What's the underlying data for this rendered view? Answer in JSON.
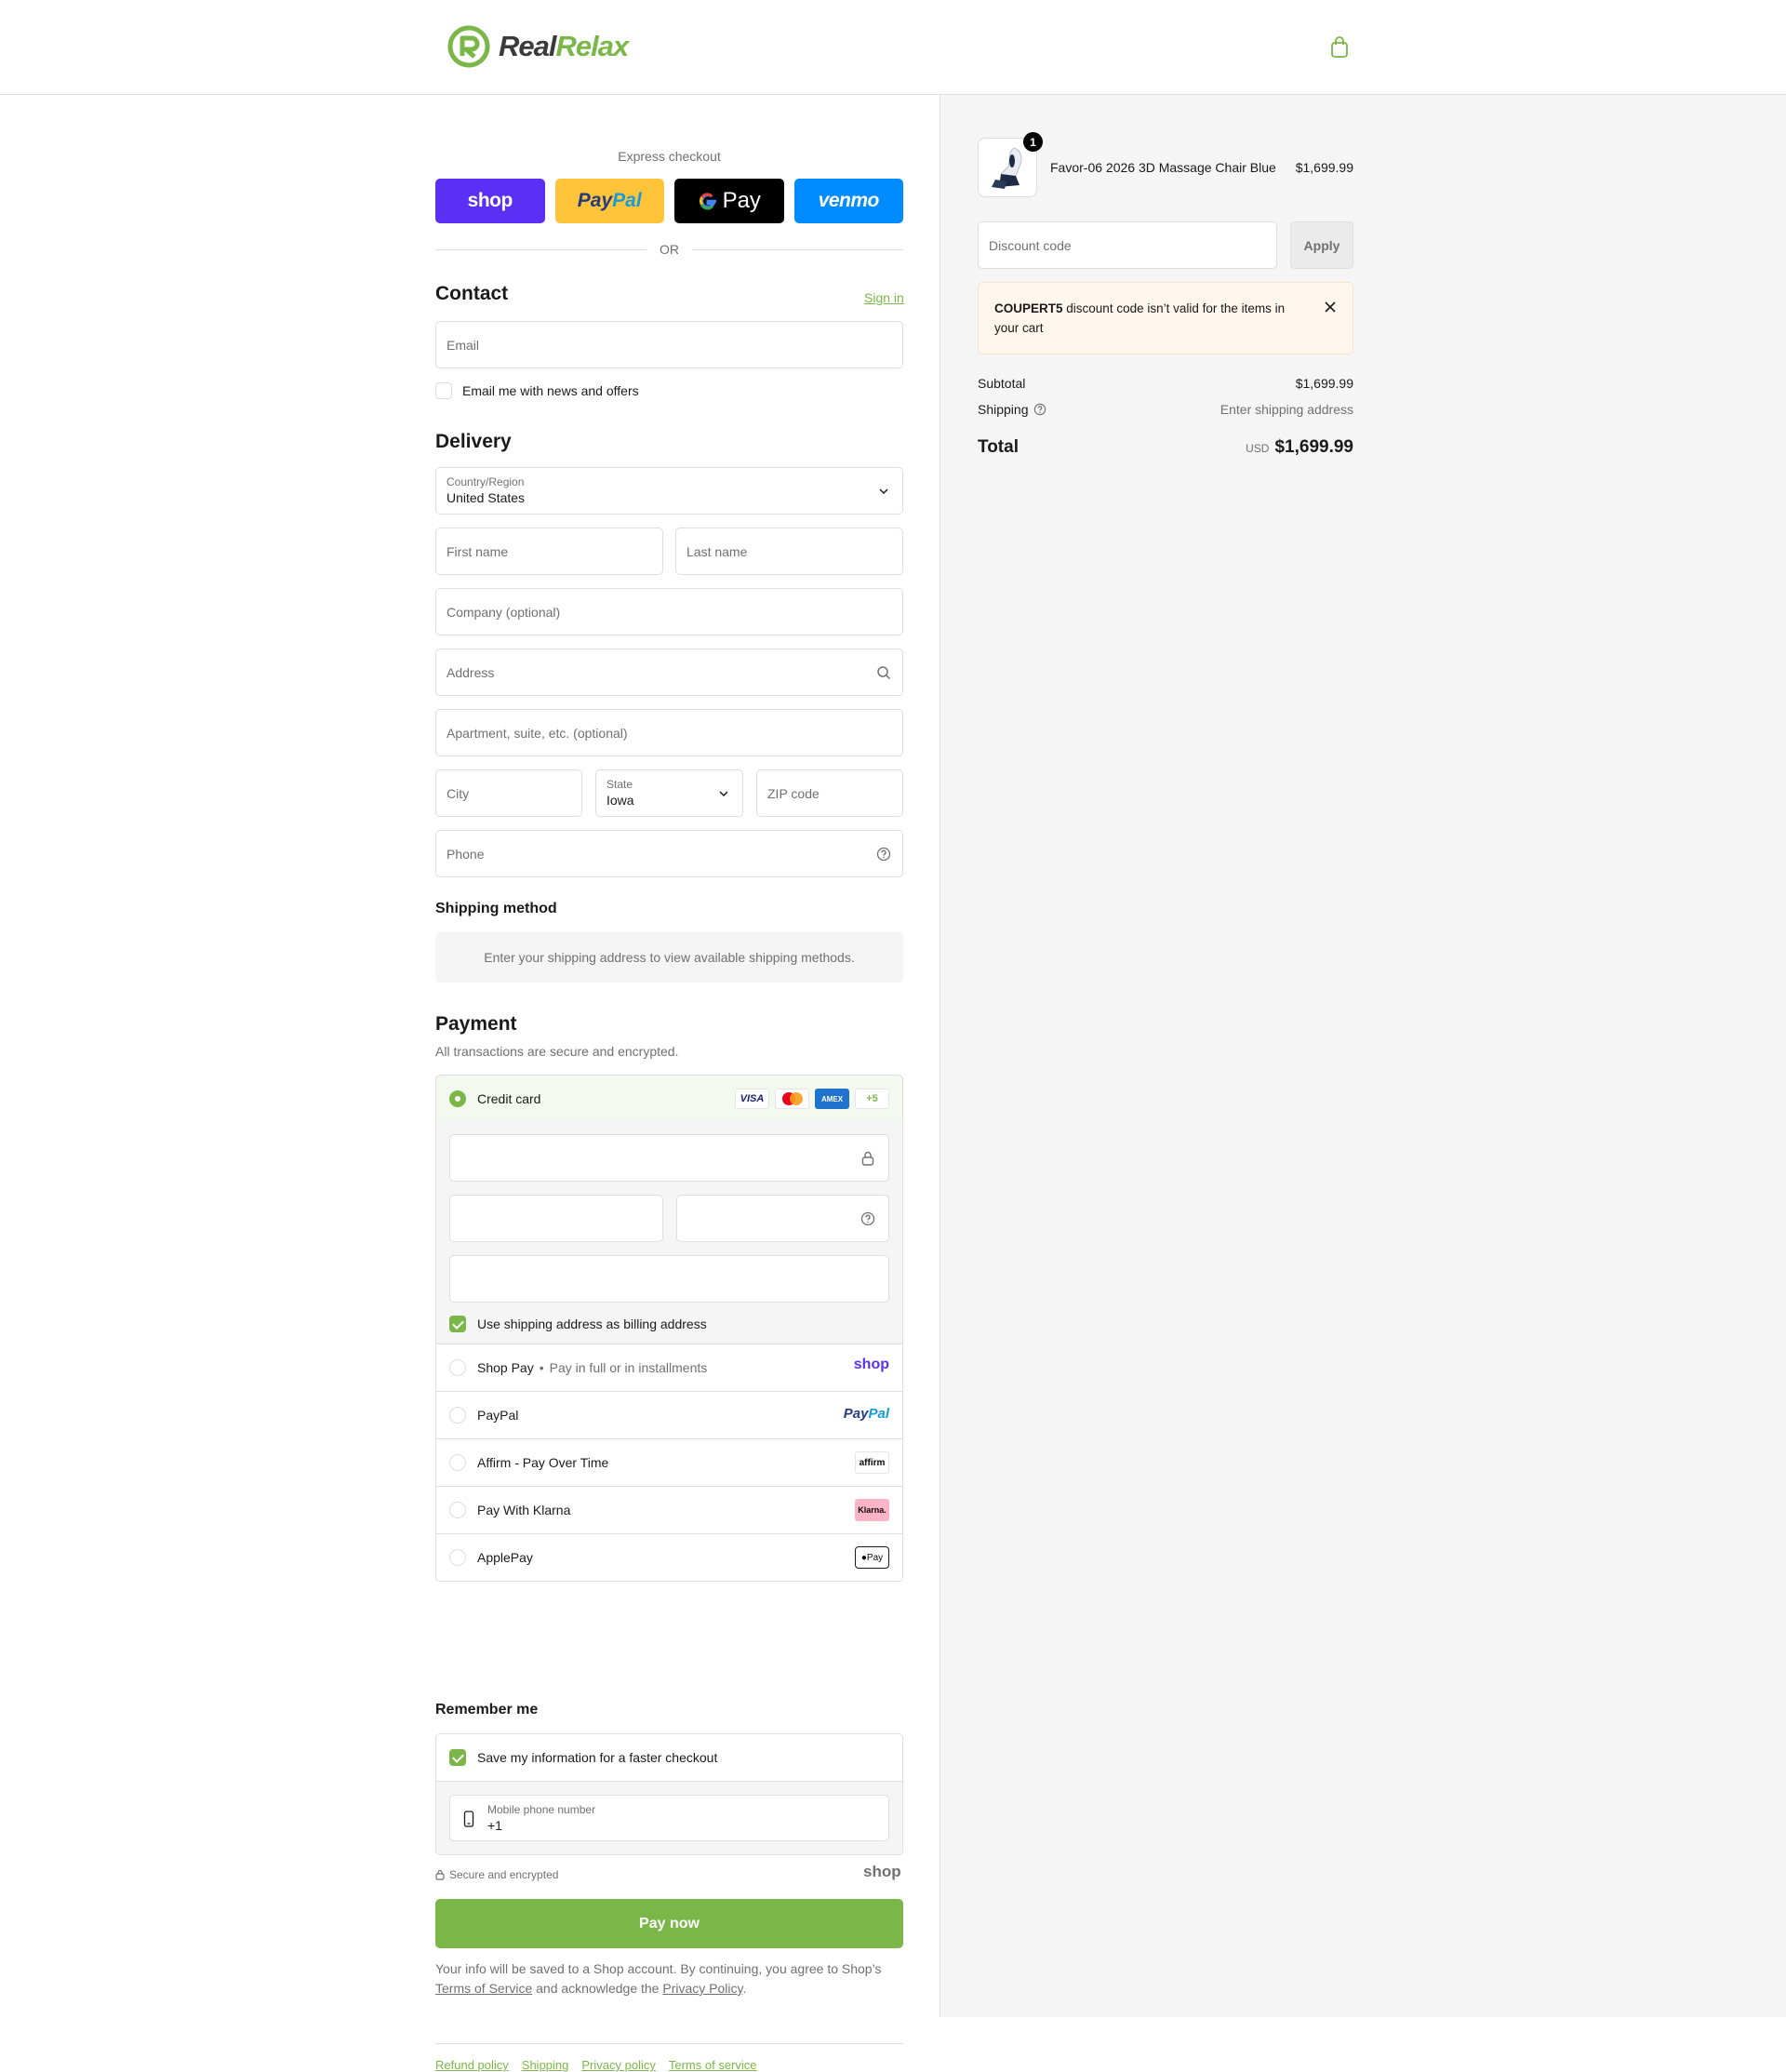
{
  "brand": {
    "part1": "Real",
    "part2": "Relax"
  },
  "express": {
    "title": "Express checkout",
    "shop_label": "shop",
    "paypal_a": "Pay",
    "paypal_b": "Pal",
    "gpay_label": "Pay",
    "venmo_label": "venmo",
    "or_label": "OR"
  },
  "contact": {
    "heading": "Contact",
    "sign_in": "Sign in",
    "email_placeholder": "Email",
    "news_label": "Email me with news and offers"
  },
  "delivery": {
    "heading": "Delivery",
    "country_label": "Country/Region",
    "country_value": "United States",
    "first_name": "First name",
    "last_name": "Last name",
    "company": "Company (optional)",
    "address": "Address",
    "apartment": "Apartment, suite, etc. (optional)",
    "city": "City",
    "state_label": "State",
    "state_value": "Iowa",
    "zip": "ZIP code",
    "phone": "Phone"
  },
  "shipping_method": {
    "heading": "Shipping method",
    "message": "Enter your shipping address to view available shipping methods."
  },
  "payment": {
    "heading": "Payment",
    "subtitle": "All transactions are secure and encrypted.",
    "credit_card": "Credit card",
    "card_brands": [
      "VISA",
      "AMEX",
      "+5"
    ],
    "billing_label": "Use shipping address as billing address",
    "options": [
      {
        "label": "Shop Pay",
        "sub": "Pay in full or in installments",
        "logo": "shop"
      },
      {
        "label": "PayPal",
        "logo_a": "Pay",
        "logo_b": "Pal"
      },
      {
        "label": "Affirm - Pay Over Time",
        "logo": "affirm"
      },
      {
        "label": "Pay With Klarna",
        "logo": "Klarna."
      },
      {
        "label": "ApplePay",
        "logo": "Pay"
      }
    ]
  },
  "remember": {
    "heading": "Remember me",
    "save_label": "Save my information for a faster checkout",
    "mobile_label": "Mobile phone number",
    "mobile_value": "+1",
    "secure_label": "Secure and encrypted",
    "shop_logo": "shop"
  },
  "pay_now": "Pay now",
  "legal": {
    "text1": "Your info will be saved to a Shop account. By continuing, you agree to Shop’s",
    "terms": "Terms of Service",
    "text2": "and acknowledge the",
    "privacy": "Privacy Policy",
    "end": "."
  },
  "footer": [
    "Refund policy",
    "Shipping",
    "Privacy policy",
    "Terms of service"
  ],
  "summary": {
    "product_name": "Favor-06 2026 3D Massage Chair Blue",
    "product_price": "$1,699.99",
    "qty": "1",
    "discount_placeholder": "Discount code",
    "apply": "Apply",
    "alert_code": "COUPERT5",
    "alert_text": "discount code isn’t valid for the items in your cart",
    "subtotal_label": "Subtotal",
    "subtotal_value": "$1,699.99",
    "shipping_label": "Shipping",
    "shipping_value": "Enter shipping address",
    "total_label": "Total",
    "currency": "USD",
    "total_value": "$1,699.99"
  },
  "colors": {
    "accent": "#7ab648",
    "shop_purple": "#5a31f4",
    "paypal_yellow": "#ffc439",
    "venmo_blue": "#008cff"
  }
}
